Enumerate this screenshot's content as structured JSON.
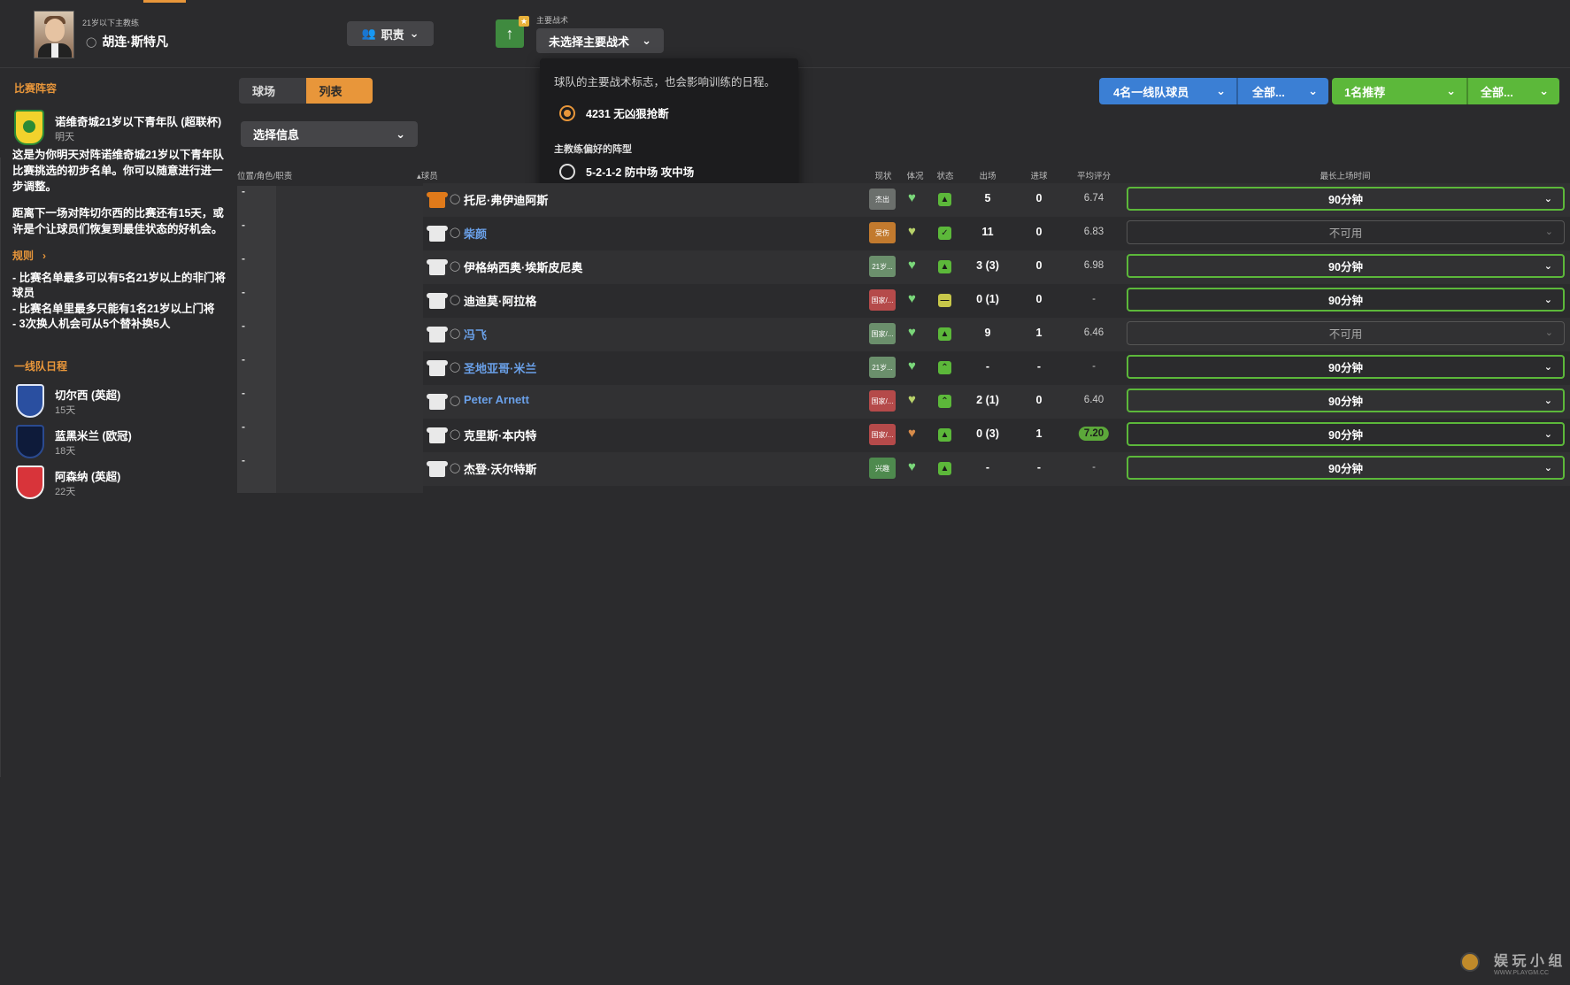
{
  "header": {
    "coach_role": "21岁以下主教练",
    "coach_name": "胡连·斯特凡",
    "duty_label": "职责",
    "tactic_label": "主要战术",
    "tactic_select": "未选择主要战术"
  },
  "tactic_popup": {
    "description": "球队的主要战术标志，也会影响训练的日程。",
    "option_selected": "4231 无凶狠抢断",
    "preferred_label": "主教练偏好的阵型",
    "option_other": "5-2-1-2 防中场 攻中场"
  },
  "sidebar": {
    "section_lineup": "比赛阵容",
    "match_title": "诺维奇城21岁以下青年队 (超联杯)",
    "match_when": "明天",
    "para1": "这是为你明天对阵诺维奇城21岁以下青年队比赛挑选的初步名单。你可以随意进行进一步调整。",
    "para2": "距离下一场对阵切尔西的比赛还有15天，或许是个让球员们恢复到最佳状态的好机会。",
    "rules_label": "规则",
    "rule1": "- 比赛名单最多可以有5名21岁以上的非门将球员",
    "rule2": "- 比赛名单里最多只能有1名21岁以上门将",
    "rule3": "- 3次换人机会可从5个替补换5人",
    "section_schedule": "一线队日程",
    "schedule": [
      {
        "name": "切尔西 (英超)",
        "days": "15天"
      },
      {
        "name": "蓝黑米兰 (欧冠)",
        "days": "18天"
      },
      {
        "name": "阿森纳 (英超)",
        "days": "22天"
      }
    ]
  },
  "controls": {
    "seg_pitch": "球场",
    "seg_list": "列表",
    "select_info": "选择信息",
    "blue_main": "4名一线队球员",
    "blue_sub": "全部...",
    "green_main": "1名推荐",
    "green_sub": "全部..."
  },
  "table": {
    "headers": {
      "position": "位置/角色/职责",
      "player": "球员",
      "status": "现状",
      "condition": "体况",
      "form": "状态",
      "apps": "出场",
      "goals": "进球",
      "avg_rating": "平均评分",
      "max_minutes": "最长上场时间"
    },
    "rows": [
      {
        "pos": "-",
        "name": "托尼·弗伊迪阿斯",
        "status": "杰出",
        "apps": "5",
        "goals": "0",
        "rating": "6.74",
        "minutes": "90分钟"
      },
      {
        "pos": "-",
        "name": "柴颜",
        "status": "受伤",
        "apps": "11",
        "goals": "0",
        "rating": "6.83",
        "minutes": "不可用"
      },
      {
        "pos": "-",
        "name": "伊格纳西奥·埃斯皮尼奥",
        "status": "21岁...",
        "apps": "3 (3)",
        "goals": "0",
        "rating": "6.98",
        "minutes": "90分钟"
      },
      {
        "pos": "-",
        "name": "迪迪莫·阿拉格",
        "status": "国家/...",
        "apps": "0 (1)",
        "goals": "0",
        "rating": "-",
        "minutes": "90分钟"
      },
      {
        "pos": "-",
        "name": "冯飞",
        "status": "国家/...",
        "apps": "9",
        "goals": "1",
        "rating": "6.46",
        "minutes": "不可用"
      },
      {
        "pos": "-",
        "name": "圣地亚哥·米兰",
        "status": "21岁...",
        "apps": "-",
        "goals": "-",
        "rating": "-",
        "minutes": "90分钟"
      },
      {
        "pos": "-",
        "name": "Peter Arnett",
        "status": "国家/...",
        "apps": "2 (1)",
        "goals": "0",
        "rating": "6.40",
        "minutes": "90分钟"
      },
      {
        "pos": "-",
        "name": "克里斯·本内特",
        "status": "国家/...",
        "apps": "0 (3)",
        "goals": "1",
        "rating": "7.20",
        "minutes": "90分钟"
      },
      {
        "pos": "-",
        "name": "杰登·沃尔特斯",
        "status": "兴趣",
        "apps": "-",
        "goals": "-",
        "rating": "-",
        "minutes": "90分钟"
      }
    ]
  },
  "colors": {
    "accent": "#e8963a",
    "blue": "#3b7fd4",
    "green": "#5cb83a"
  },
  "watermark": {
    "text": "娱 玩 小 组",
    "url": "WWW.PLAYGM.CC"
  }
}
